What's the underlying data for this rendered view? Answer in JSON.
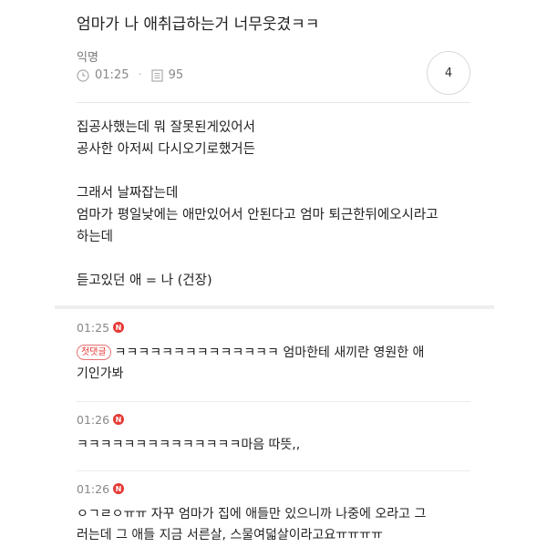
{
  "post": {
    "title": "엄마가 나 애취급하는거 너무웃겼ㅋㅋ",
    "author": "익명",
    "time": "01:25",
    "views": "95",
    "comment_count": "4",
    "body": [
      "집공사했는데 뭐 잘못된게있어서",
      "공사한 아저씨 다시오기로했거든",
      "",
      "그래서 날짜잡는데",
      "엄마가 평일낮에는 애만있어서 안된다고 엄마 퇴근한뒤에오시라고",
      "하는데",
      "",
      "듣고있던 애 = 나 (건장)"
    ]
  },
  "comments": [
    {
      "time": "01:25",
      "new_badge": "N",
      "first_badge": "첫댓글",
      "text": "ㅋㅋㅋㅋㅋㅋㅋㅋㅋㅋㅋㅋㅋㅋ 엄마한테 새끼란 영원한 애\n기인가봐"
    },
    {
      "time": "01:26",
      "new_badge": "N",
      "text": "ㅋㅋㅋㅋㅋㅋㅋㅋㅋㅋㅋㅋㅋㅋ마음 따뜻,,"
    },
    {
      "time": "01:26",
      "new_badge": "N",
      "text": "ㅇㄱㄹㅇㅠㅠ 자꾸 엄마가 집에 애들만 있으니까 나중에 오라고 그\n러는데 그 애들 지금 서른살, 스물여덟살이라고요ㅠㅠㅠㅠ"
    }
  ],
  "icons": {
    "time": "clock-icon",
    "views": "document-icon"
  },
  "colors": {
    "new_badge": "#e53935",
    "text": "#222222",
    "meta": "#888888"
  }
}
